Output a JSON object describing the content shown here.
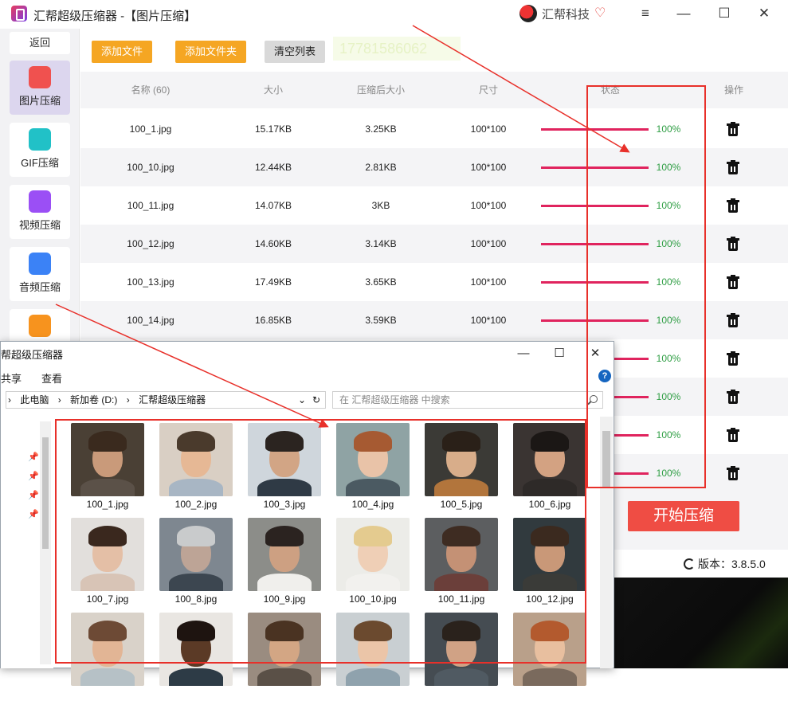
{
  "app": {
    "title": "汇帮超级压缩器 -【图片压缩】",
    "brand": "汇帮科技",
    "controls": [
      "≡",
      "—",
      "☐",
      "✕"
    ]
  },
  "sidebar": {
    "back_label": "返回",
    "items": [
      {
        "label": "图片压缩",
        "icon": "image-icon",
        "color": "#f0514f",
        "active": true
      },
      {
        "label": "GIF压缩",
        "icon": "gif-icon",
        "color": "#21c1c7",
        "active": false
      },
      {
        "label": "视频压缩",
        "icon": "video-icon",
        "color": "#9b4ff5",
        "active": false
      },
      {
        "label": "音频压缩",
        "icon": "audio-icon",
        "color": "#3b82f6",
        "active": false
      },
      {
        "label": "",
        "icon": "pdf-icon",
        "color": "#f7931e",
        "active": false
      }
    ]
  },
  "toolbar": {
    "add_file": "添加文件",
    "add_folder": "添加文件夹",
    "clear_list": "清空列表",
    "ghost_text": "17781586062"
  },
  "table": {
    "headers": {
      "name": "名称 (60)",
      "size": "大小",
      "compressed": "压缩后大小",
      "dims": "尺寸",
      "status": "状态",
      "ops": "操作"
    },
    "rows": [
      {
        "name": "100_1.jpg",
        "size": "15.17KB",
        "compressed": "3.25KB",
        "dims": "100*100",
        "pct": "100%"
      },
      {
        "name": "100_10.jpg",
        "size": "12.44KB",
        "compressed": "2.81KB",
        "dims": "100*100",
        "pct": "100%"
      },
      {
        "name": "100_11.jpg",
        "size": "14.07KB",
        "compressed": "3KB",
        "dims": "100*100",
        "pct": "100%"
      },
      {
        "name": "100_12.jpg",
        "size": "14.60KB",
        "compressed": "3.14KB",
        "dims": "100*100",
        "pct": "100%"
      },
      {
        "name": "100_13.jpg",
        "size": "17.49KB",
        "compressed": "3.65KB",
        "dims": "100*100",
        "pct": "100%"
      },
      {
        "name": "100_14.jpg",
        "size": "16.85KB",
        "compressed": "3.59KB",
        "dims": "100*100",
        "pct": "100%"
      },
      {
        "name": "",
        "size": "",
        "compressed": "",
        "dims": "",
        "pct": "100%"
      },
      {
        "name": "",
        "size": "",
        "compressed": "",
        "dims": "",
        "pct": "100%"
      },
      {
        "name": "",
        "size": "",
        "compressed": "",
        "dims": "",
        "pct": "100%"
      },
      {
        "name": "",
        "size": "",
        "compressed": "",
        "dims": "",
        "pct": "100%"
      }
    ]
  },
  "start_button": "开始压缩",
  "version": "版本：3.8.5.0",
  "explorer": {
    "title": "帮超级压缩器",
    "menu": [
      "共享",
      "查看"
    ],
    "controls": [
      "—",
      "☐",
      "✕"
    ],
    "help": "?",
    "breadcrumb": [
      "›",
      "此电脑",
      "›",
      "新加卷 (D:)",
      "›",
      "汇帮超级压缩器"
    ],
    "refresh": "↻",
    "dropdown": "⌄",
    "search_placeholder": "在 汇帮超级压缩器 中搜索",
    "files": [
      {
        "name": "100_1.jpg",
        "bg": "#4a4035",
        "skin": "#c99a7a",
        "hair": "#3a2a1e",
        "body": "#5b5148"
      },
      {
        "name": "100_2.jpg",
        "bg": "#d9cfc4",
        "skin": "#e6b895",
        "hair": "#4a3a2c",
        "body": "#a8b6c4"
      },
      {
        "name": "100_3.jpg",
        "bg": "#cfd6dc",
        "skin": "#d2a585",
        "hair": "#2b2420",
        "body": "#2f3a45"
      },
      {
        "name": "100_4.jpg",
        "bg": "#8fa3a4",
        "skin": "#e9c3a8",
        "hair": "#a65a32",
        "body": "#4b5a62"
      },
      {
        "name": "100_5.jpg",
        "bg": "#3b3a36",
        "skin": "#d8ad8a",
        "hair": "#2a2018",
        "body": "#b2753c"
      },
      {
        "name": "100_6.jpg",
        "bg": "#3a3432",
        "skin": "#d3a282",
        "hair": "#1b1715",
        "body": "#2e2a28"
      },
      {
        "name": "100_7.jpg",
        "bg": "#e2dfdc",
        "skin": "#e4bfa6",
        "hair": "#3a281e",
        "body": "#d8c4b6"
      },
      {
        "name": "100_8.jpg",
        "bg": "#7e8790",
        "skin": "#bda496",
        "hair": "#c9cbcc",
        "body": "#3c4650"
      },
      {
        "name": "100_9.jpg",
        "bg": "#8c8d89",
        "skin": "#cda082",
        "hair": "#2b2320",
        "body": "#f0efec"
      },
      {
        "name": "100_10.jpg",
        "bg": "#ecece8",
        "skin": "#efcfb6",
        "hair": "#e4cb8f",
        "body": "#f2f1ee"
      },
      {
        "name": "100_11.jpg",
        "bg": "#5c5e60",
        "skin": "#c49175",
        "hair": "#3e2c22",
        "body": "#6b3f3a"
      },
      {
        "name": "100_12.jpg",
        "bg": "#313a3e",
        "skin": "#c99878",
        "hair": "#3b2a1f",
        "body": "#3a3b38"
      },
      {
        "name": "",
        "bg": "#d9d2c9",
        "skin": "#e2b595",
        "hair": "#6d4a35",
        "body": "#b6c1c6"
      },
      {
        "name": "",
        "bg": "#e9e6e2",
        "skin": "#5b3a26",
        "hair": "#1e1410",
        "body": "#2d3b46"
      },
      {
        "name": "",
        "bg": "#9a8c80",
        "skin": "#d3a684",
        "hair": "#4a3322",
        "body": "#5a5047"
      },
      {
        "name": "",
        "bg": "#c9cfd2",
        "skin": "#ebc5a8",
        "hair": "#6b4a2f",
        "body": "#8fa2ad"
      },
      {
        "name": "",
        "bg": "#454c52",
        "skin": "#d0a285",
        "hair": "#2a221c",
        "body": "#505a62"
      },
      {
        "name": "",
        "bg": "#b9a08a",
        "skin": "#e8bf9f",
        "hair": "#b35a2e",
        "body": "#7a6a5d"
      }
    ]
  },
  "colors": {
    "accent": "#f5a623",
    "progress": "#e0245e",
    "done": "#2f9e44",
    "start": "#ef4d44",
    "annotation": "#e8302a"
  }
}
